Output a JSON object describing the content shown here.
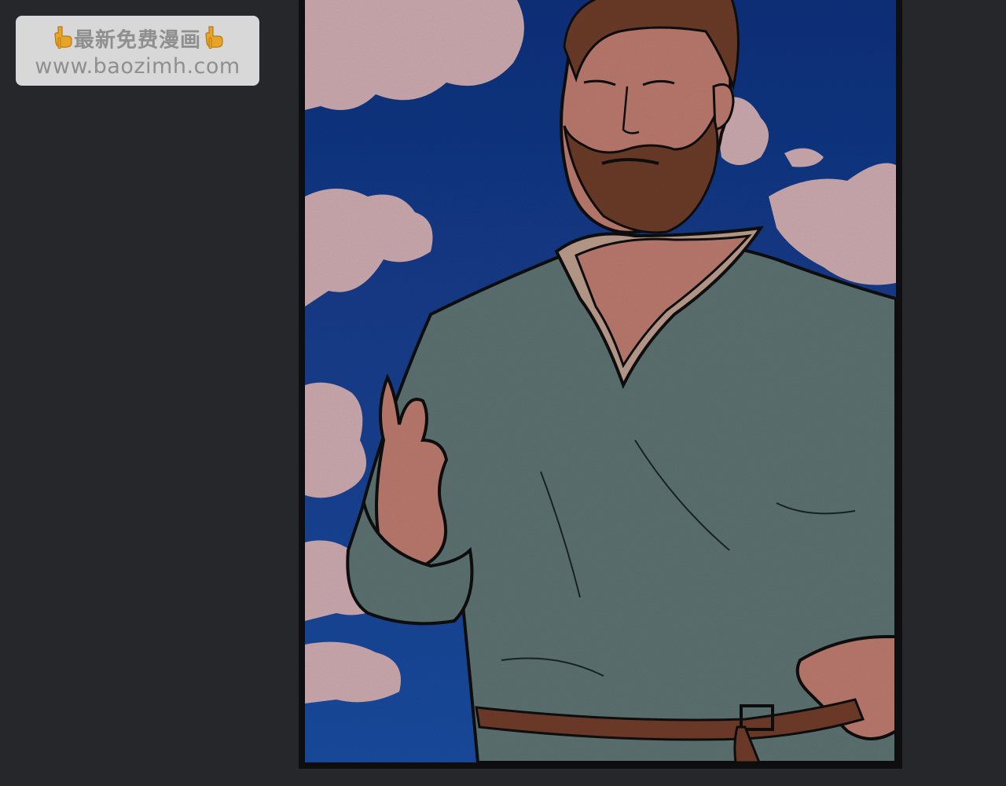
{
  "page": {
    "background_color": "#26272b"
  },
  "watermark": {
    "line1": "最新免费漫画",
    "line2": "www.baozimh.com",
    "hand_icon": "pointing-down-hand-icon",
    "background_color": "#d8d8d8",
    "text_color": "#8f8f8f"
  },
  "comic_panel": {
    "frame_color": "#0e0e10",
    "colors": {
      "sky": "#143c8c",
      "cloud": "#c9a8ad",
      "shirt": "#5c7070",
      "skin": "#b8786c",
      "beard": "#6a3a28",
      "belt": "#6e3a2a"
    }
  }
}
